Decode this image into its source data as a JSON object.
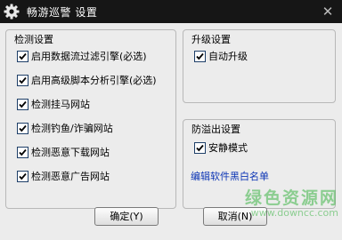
{
  "window": {
    "title": "畅游巡警 设置",
    "close_glyph": "✕",
    "icon": "gear-icon"
  },
  "detection": {
    "title": "检测设置",
    "options": [
      {
        "label": "启用数据流过滤引擎(必选)",
        "checked": true
      },
      {
        "label": "启用高级脚本分析引擎(必选)",
        "checked": true
      },
      {
        "label": "检测挂马网站",
        "checked": true
      },
      {
        "label": "检测钓鱼/诈骗网站",
        "checked": true
      },
      {
        "label": "检测恶意下载网站",
        "checked": true
      },
      {
        "label": "检测恶意广告网站",
        "checked": true
      }
    ]
  },
  "upgrade": {
    "title": "升级设置",
    "options": [
      {
        "label": "自动升级",
        "checked": true
      }
    ]
  },
  "overflow": {
    "title": "防溢出设置",
    "options": [
      {
        "label": "安静模式",
        "checked": true
      }
    ],
    "blacklist_link": "编辑软件黑白名单"
  },
  "buttons": {
    "ok": "确定(Y)",
    "cancel": "取消(N)"
  },
  "watermark": {
    "main": "绿色资源网",
    "sub": "www.downcc.com"
  },
  "colors": {
    "titlebar": "#161616",
    "link": "#0c35b5",
    "checkbox_border": "#1e3f68"
  }
}
